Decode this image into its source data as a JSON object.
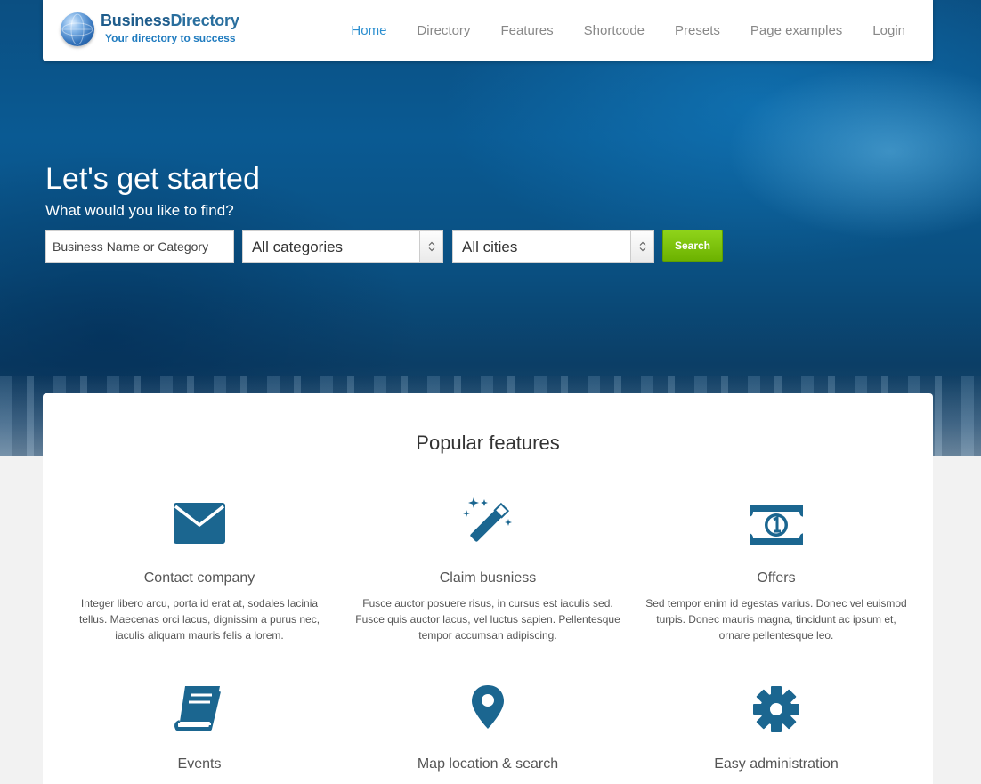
{
  "brand": {
    "name_part1": "Business",
    "name_part2": "Directory",
    "tagline": "Your directory to success"
  },
  "nav": {
    "items": [
      {
        "label": "Home",
        "active": true
      },
      {
        "label": "Directory",
        "active": false
      },
      {
        "label": "Features",
        "active": false
      },
      {
        "label": "Shortcode",
        "active": false
      },
      {
        "label": "Presets",
        "active": false
      },
      {
        "label": "Page examples",
        "active": false
      },
      {
        "label": "Login",
        "active": false
      }
    ]
  },
  "hero": {
    "title": "Let's get started",
    "subtitle": "What would you like to find?"
  },
  "search": {
    "placeholder": "Business Name or Category",
    "category_value": "All categories",
    "city_value": "All cities",
    "button_label": "Search"
  },
  "features": {
    "heading": "Popular features",
    "items": [
      {
        "icon": "envelope-icon",
        "title": "Contact company",
        "description": "Integer libero arcu, porta id erat at, sodales lacinia tellus. Maecenas orci lacus, dignissim a purus nec, iaculis aliquam mauris felis a lorem."
      },
      {
        "icon": "magic-wand-icon",
        "title": "Claim busniess",
        "description": "Fusce auctor posuere risus, in cursus est iaculis sed. Fusce quis auctor lacus, vel luctus sapien. Pellentesque tempor  accumsan adipiscing."
      },
      {
        "icon": "money-bill-icon",
        "title": "Offers",
        "description": "Sed tempor enim id egestas varius. Donec vel euismod turpis. Donec mauris magna, tincidunt ac ipsum et, ornare pellentesque leo."
      },
      {
        "icon": "book-icon",
        "title": "Events",
        "description": ""
      },
      {
        "icon": "map-pin-icon",
        "title": "Map location & search",
        "description": ""
      },
      {
        "icon": "gear-icon",
        "title": "Easy administration",
        "description": ""
      }
    ]
  },
  "colors": {
    "accent": "#2c8fd0",
    "icon": "#1b6690",
    "search_button": "#7cc40a"
  }
}
